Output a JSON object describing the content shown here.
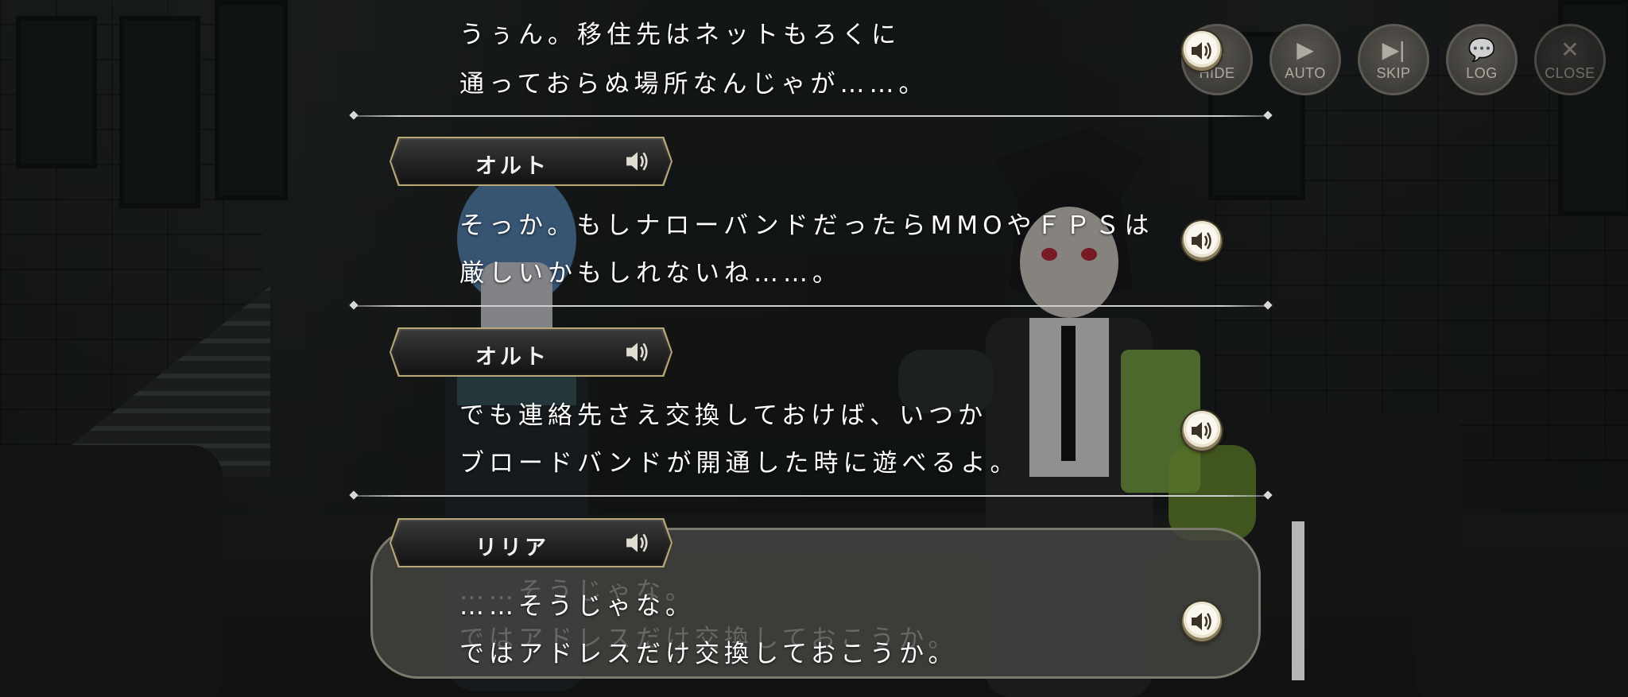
{
  "menu": {
    "hide": "HIDE",
    "auto": "AUTO",
    "skip": "SKIP",
    "log": "LOG",
    "close": "CLOSE"
  },
  "log": {
    "entries": [
      {
        "speaker": "",
        "lines": [
          "うぅん。移住先はネットもろくに",
          "通っておらぬ場所なんじゃが……。"
        ]
      },
      {
        "speaker": "オルト",
        "lines": [
          "そっか。もしナローバンドだったらMMOやＦＰＳは",
          "厳しいかもしれないね……。"
        ]
      },
      {
        "speaker": "オルト",
        "lines": [
          "でも連絡先さえ交換しておけば、いつか",
          "ブロードバンドが開通した時に遊べるよ。"
        ]
      },
      {
        "speaker": "リリア",
        "lines": [
          "……そうじゃな。",
          "ではアドレスだけ交換しておこうか。"
        ]
      }
    ]
  },
  "icons": {
    "speaker": "speaker-icon",
    "hide": "edit-icon",
    "auto": "play-icon",
    "skip": "skip-icon",
    "log": "chat-icon",
    "close": "close-icon"
  },
  "colors": {
    "accent_gold": "#b8a878",
    "text": "#ffffff"
  }
}
